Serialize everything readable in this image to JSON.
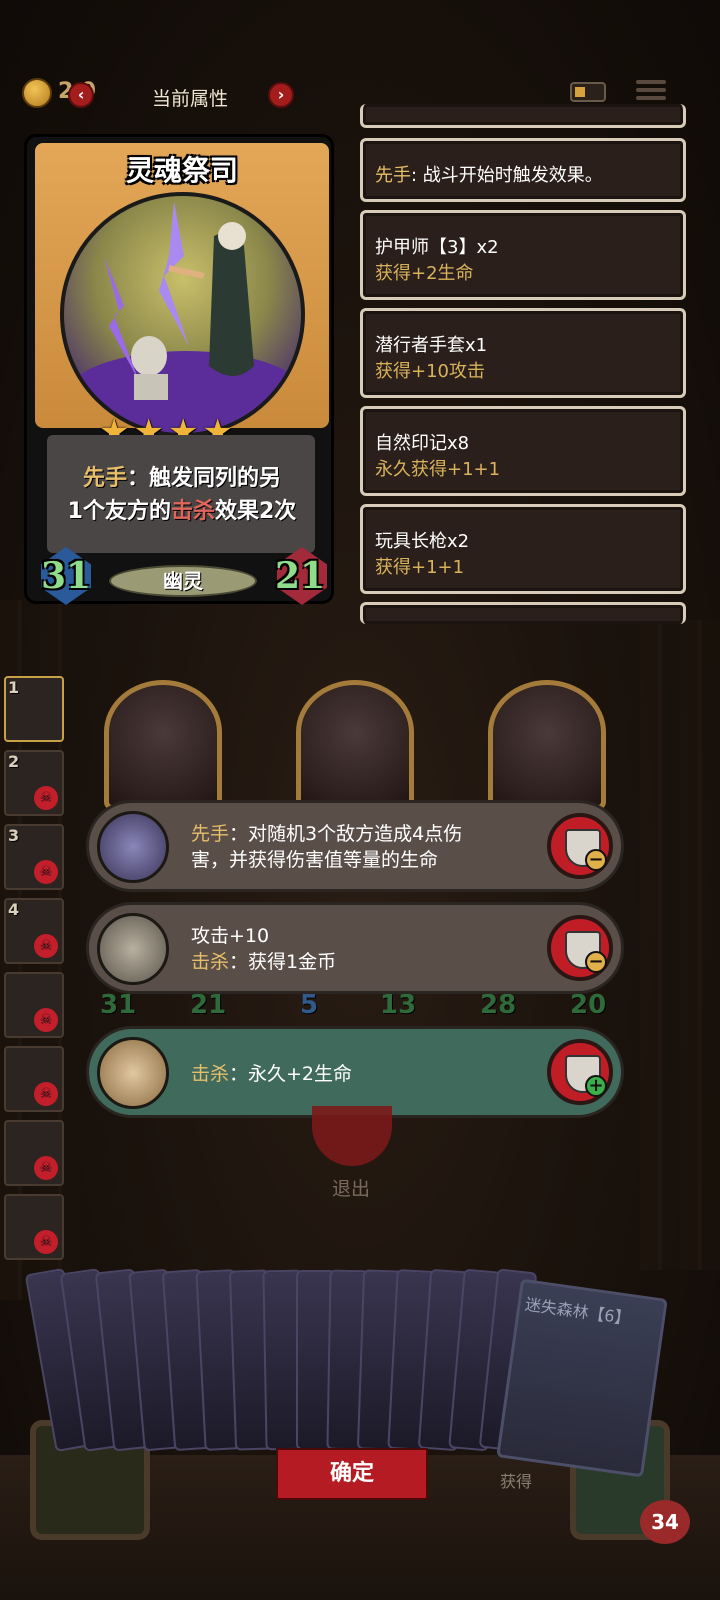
{
  "top_bar": {
    "title": "当前属性",
    "coin_value": "2 9",
    "prev_label": "‹",
    "next_label": "›"
  },
  "card": {
    "name": "灵魂祭司",
    "stars": "★★★★",
    "desc_line1_gold": "先手",
    "desc_line1_rest": "：触发同列的另",
    "desc_line2_a": "1个友方的",
    "desc_line2_red": "击杀",
    "desc_line2_b": "效果2次",
    "attack": "31",
    "health": "21",
    "type": "幽灵"
  },
  "attributes": [
    {
      "title_gold": "先手",
      "title_rest": ": 战斗开始时触发效果。",
      "sub": ""
    },
    {
      "title": "护甲师【3】x2",
      "sub": "获得+2生命"
    },
    {
      "title": "潜行者手套x1",
      "sub": "获得+10攻击"
    },
    {
      "title": "自然印记x8",
      "sub": "永久获得+1+1"
    },
    {
      "title": "玩具长枪x2",
      "sub": "获得+1+1"
    }
  ],
  "board": {
    "side_numbers": [
      "1",
      "2",
      "3",
      "4"
    ],
    "stat_row": [
      "31",
      "21",
      "5",
      "13",
      "28",
      "20"
    ]
  },
  "effects": [
    {
      "gold": "先手",
      "rest": "：对随机3个敌方造成4点伤",
      "line2": "害，并获得伤害值等量的生命",
      "action": "minus"
    },
    {
      "line1": "攻击+10",
      "gold": "击杀",
      "rest": "：获得1金币",
      "action": "minus"
    },
    {
      "gold": "击杀",
      "rest": "：永久+2生命",
      "action": "plus"
    }
  ],
  "exit_label": "退出",
  "hand": {
    "forest_card_label": "迷失森林【6】",
    "partial_text": "获得"
  },
  "confirm_label": "确定",
  "player_hp": "34",
  "colors": {
    "accent_red": "#b51b22",
    "gold_text": "#d9b25c",
    "green_row": "#3f6a5c"
  }
}
